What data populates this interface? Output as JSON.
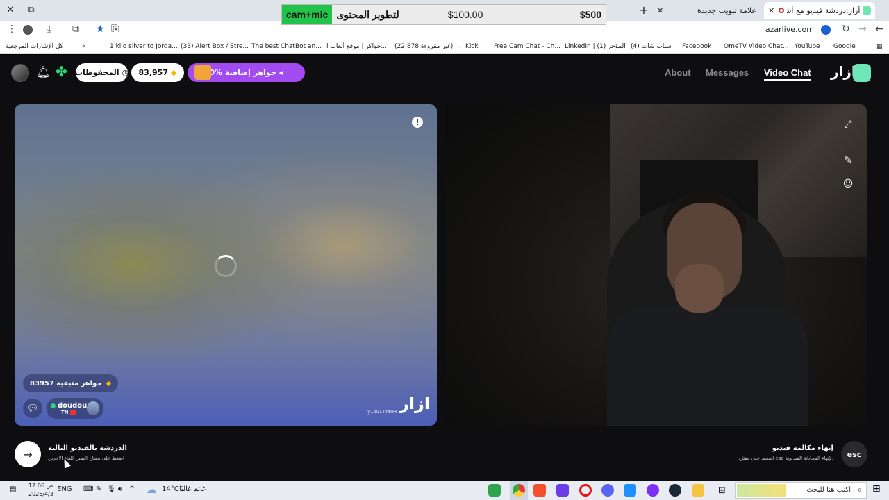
{
  "browser": {
    "tabs": [
      {
        "title": "أزار:دردشة فيديو مع أشخاص"
      },
      {
        "title": "علامة تبويب جديدة"
      }
    ],
    "window_controls": {
      "close": "✕",
      "restore": "⧉",
      "minimize": "—"
    },
    "new_tab": "+",
    "url": "azarlive.com",
    "bookmarks": [
      "Google",
      "YouTube",
      "OmeTV Video Chat...",
      "Facebook",
      "(4) سناب شات",
      "LinkedIn | المؤجر (1)",
      "Free Cam Chat - Ch...",
      "Kick",
      "(22,878 غير مقروءة) ...",
      "جواكر | موقع ألعاب ا...",
      "The best ChatBot an...",
      "(33) Alert Box / Stre...",
      "1 kilo silver to Jorda...",
      "كل الإشارات المرجعية"
    ],
    "bookmarks_more": "«"
  },
  "overlay_banner": {
    "green_label": "cam+mic",
    "label": "لتطوير المحتوى",
    "amount1": "$100.00",
    "amount2": "$500"
  },
  "app": {
    "logo_text": "ازار",
    "nav": {
      "video_chat": "Video Chat",
      "messages": "Messages",
      "about": "About"
    },
    "promo": "10% جواهر إضافية ◂",
    "gems_count": "83,957",
    "saved_label": "المحفوظات",
    "left_panel": {
      "gems_remaining": "83957 جواهر متبقية",
      "partner_name": "doudou",
      "partner_country": "TN",
      "watermark_logo": "ازار",
      "watermark_id": "y1buITYmeH"
    },
    "next": {
      "title": "الدردشة بالفيديو التالية",
      "hint": "اضغط على مفتاح اليمين للقاء الآخرين"
    },
    "end_call": {
      "key": "esc",
      "title": "إنهاء مكالمة فيديو",
      "hint": "اضغط على مفتاح esc لإنهاء المحادثة الفيديوية."
    }
  },
  "taskbar": {
    "search_placeholder": "اكتب هنا للبحث",
    "weather_temp": "14°C",
    "weather_desc": "غائم غالبًا",
    "language": "ENG",
    "time": "12:06 ص",
    "date": "2026/4/3"
  },
  "colors": {
    "accent_purple": "#a24bf0",
    "brand_mint": "#6ee7b7",
    "banner_green": "#22c34b"
  }
}
